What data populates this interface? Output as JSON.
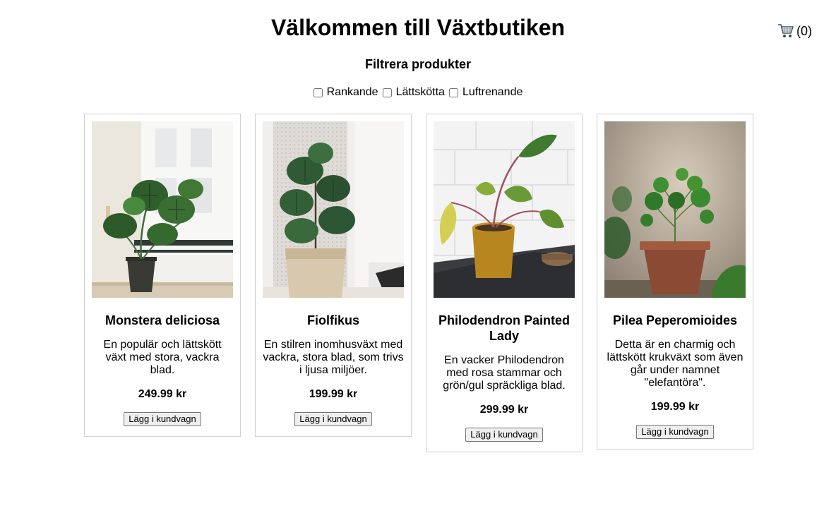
{
  "header": {
    "title": "Välkommen till Växtbutiken",
    "cart_icon": "shopping-cart-icon",
    "cart_count": "(0)"
  },
  "filters": {
    "heading": "Filtrera produkter",
    "options": [
      {
        "label": "Rankande",
        "checked": false
      },
      {
        "label": "Lättskötta",
        "checked": false
      },
      {
        "label": "Luftrenande",
        "checked": false
      }
    ]
  },
  "products": [
    {
      "name": "Monstera deliciosa",
      "description": "En populär och lättskött växt med stora, vackra blad.",
      "price": "249.99 kr",
      "button": "Lägg i kundvagn"
    },
    {
      "name": "Fiolfikus",
      "description": "En stilren inomhusväxt med vackra, stora blad, som trivs i ljusa miljöer.",
      "price": "199.99 kr",
      "button": "Lägg i kundvagn"
    },
    {
      "name": "Philodendron Painted Lady",
      "description": "En vacker Philodendron med rosa stammar och grön/gul spräckliga blad.",
      "price": "299.99 kr",
      "button": "Lägg i kundvagn"
    },
    {
      "name": "Pilea Peperomioides",
      "description": "Detta är en charmig och lättskött krukväxt som även går under namnet \"elefantöra\".",
      "price": "199.99 kr",
      "button": "Lägg i kundvagn"
    }
  ]
}
